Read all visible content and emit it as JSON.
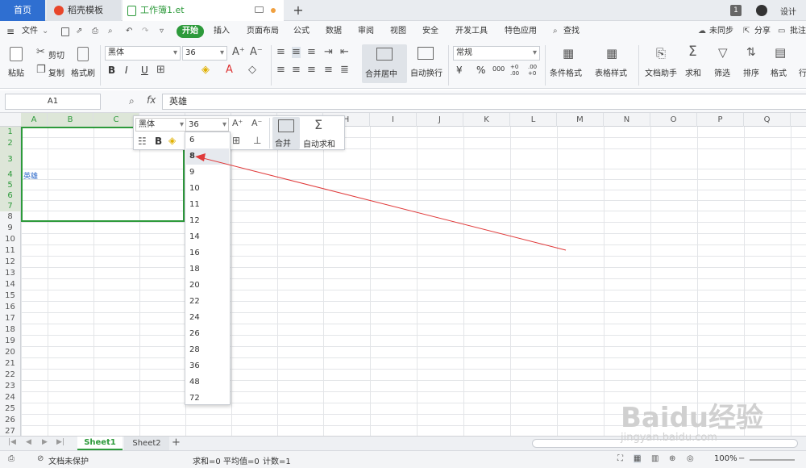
{
  "tabs": {
    "home": "首页",
    "daoke": "稻壳模板",
    "file": "工作簿1.et",
    "new_tab": "+"
  },
  "window": {
    "count_badge": "1",
    "design": "设计"
  },
  "menu": {
    "file": "文件",
    "items": [
      "开始",
      "插入",
      "页面布局",
      "公式",
      "数据",
      "审阅",
      "视图",
      "安全",
      "开发工具",
      "特色应用"
    ],
    "search": "查找",
    "sync": "未同步",
    "share": "分享",
    "comment": "批注"
  },
  "ribbon": {
    "paste": "粘贴",
    "cut": "剪切",
    "copy": "复制",
    "format_painter": "格式刷",
    "font_name": "黑体",
    "font_size": "36",
    "bold": "B",
    "italic": "I",
    "underline": "U",
    "merge_center": "合并居中",
    "auto_wrap": "自动换行",
    "number_format": "常规",
    "currency": "¥",
    "percent": "%",
    "thousands": "000",
    "inc_decimal": "+0 .00",
    "dec_decimal": ".00 +0",
    "conditional_format": "条件格式",
    "table_style": "表格样式",
    "doc_assistant": "文档助手",
    "sum": "求和",
    "filter": "筛选",
    "sort": "排序",
    "format": "格式",
    "row_col": "行"
  },
  "formula_bar": {
    "cell_ref": "A1",
    "fx": "fx",
    "content": "英雄"
  },
  "columns": [
    "A",
    "B",
    "C",
    "D",
    "E",
    "F",
    "G",
    "H",
    "I",
    "J",
    "K",
    "L",
    "M",
    "N",
    "O",
    "P",
    "Q"
  ],
  "rows": [
    "1",
    "2",
    "3",
    "4",
    "5",
    "6",
    "7",
    "8",
    "9",
    "10",
    "11",
    "12",
    "13",
    "14",
    "15",
    "16",
    "17",
    "18",
    "19",
    "20",
    "21",
    "22",
    "23",
    "24",
    "25",
    "26",
    "27",
    "28"
  ],
  "cell_text": "英雄",
  "mini_toolbar": {
    "font_name": "黑体",
    "font_size": "36",
    "bold": "B",
    "merge": "合并",
    "autosum": "自动求和"
  },
  "size_options": [
    "6",
    "8",
    "9",
    "10",
    "11",
    "12",
    "14",
    "16",
    "18",
    "20",
    "22",
    "24",
    "26",
    "28",
    "36",
    "48",
    "72"
  ],
  "sheets": {
    "tabs": [
      "Sheet1",
      "Sheet2"
    ],
    "add": "+"
  },
  "status": {
    "protect": "文档未保护",
    "sum": "求和=0",
    "avg": "平均值=0",
    "count": "计数=1",
    "zoom": "100%"
  },
  "watermark": {
    "logo": "Baidu经验",
    "url": "jingyan.baidu.com"
  },
  "colors": {
    "accent_green": "#2d9a3b",
    "tab_blue": "#2f6fd1",
    "arrow_red": "#e03a3a",
    "cell_text_blue": "#2a67c8"
  }
}
